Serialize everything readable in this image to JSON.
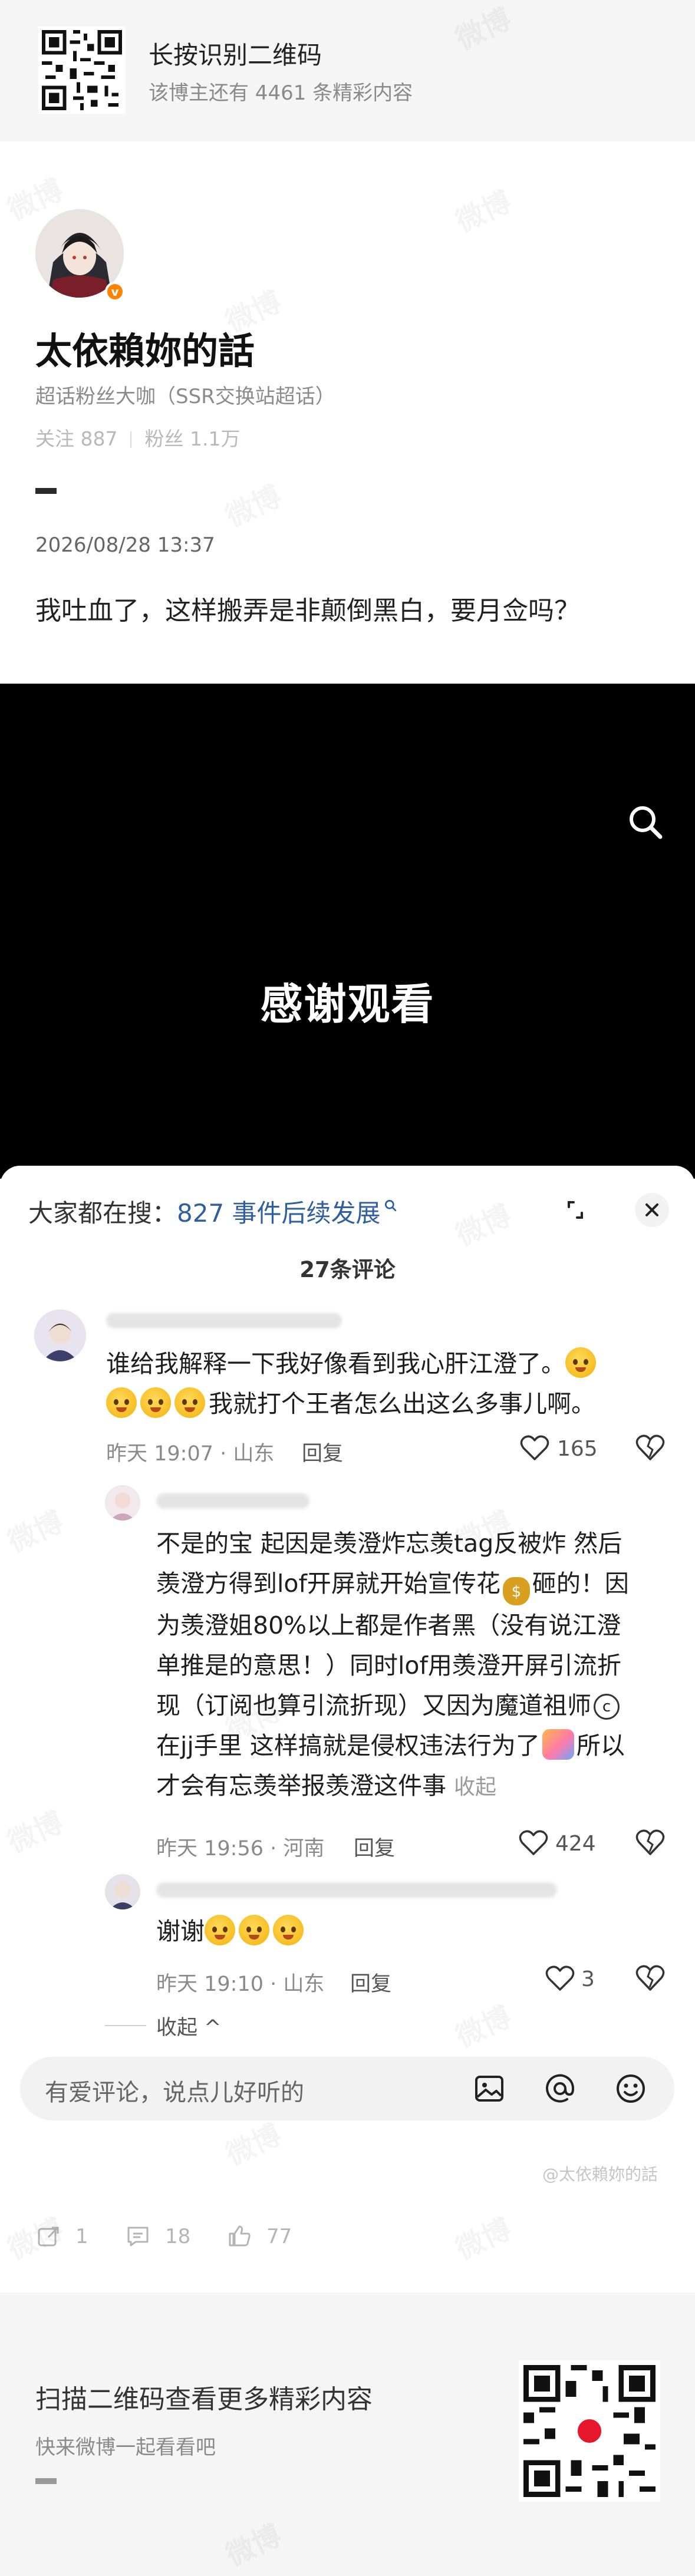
{
  "top_banner": {
    "title": "长按识别二维码",
    "subtitle": "该博主还有 4461 条精彩内容"
  },
  "author": {
    "name": "太依賴妳的話",
    "title": "超话粉丝大咖（SSR交换站超话）",
    "follow_label": "关注 887",
    "fans_label": "粉丝 1.1万",
    "verified_color": "#ff8200"
  },
  "post": {
    "time": "2026/08/28 13:37",
    "text": "我吐血了，这样搬弄是非颠倒黑白，要月佥吗？"
  },
  "video": {
    "text": "感谢观看",
    "search_icon": "search-icon"
  },
  "comments_sheet": {
    "hot_prefix": "大家都在搜：",
    "hot_topic": "827 事件后续发展",
    "count_label": "27条评论",
    "comments": [
      {
        "line1": "谁给我解释一下我好像看到我心肝江澄了。",
        "line2": "我就打个王者怎么出这么多事儿啊。",
        "time_location": "昨天 19:07 · 山东",
        "reply_label": "回复",
        "likes": "165"
      },
      {
        "lines": [
          "不是的宝 起因是羡澄炸忘羡tag反被炸 然后",
          "羡澄方得到lof开屏就开始宣传花",
          "砸的！因",
          "为羡澄姐80%以上都是作者黑（没有说江澄",
          "单推是的意思！）同时lof用羡澄开屏引流折",
          "现（订阅也算引流折现）又因为魔道祖师",
          "在jj手里 这样搞就是侵权违法行为了",
          "所以",
          "才会有忘羡举报羡澄这件事"
        ],
        "collapse_inline": "收起",
        "time_location": "昨天 19:56 · 河南",
        "reply_label": "回复",
        "likes": "424"
      },
      {
        "text": "谢谢",
        "time_location": "昨天 19:10 · 山东",
        "reply_label": "回复",
        "likes": "3"
      }
    ],
    "collapse_label": "收起",
    "collapse_chevron": "^",
    "input_placeholder": "有爱评论，说点儿好听的"
  },
  "footer": {
    "watermark_user": "@太依賴妳的話",
    "reposts": "1",
    "comments": "18",
    "likes": "77"
  },
  "bottom_banner": {
    "title": "扫描二维码查看更多精彩内容",
    "subtitle": "快来微博一起看看吧"
  },
  "watermark_text": "微博"
}
